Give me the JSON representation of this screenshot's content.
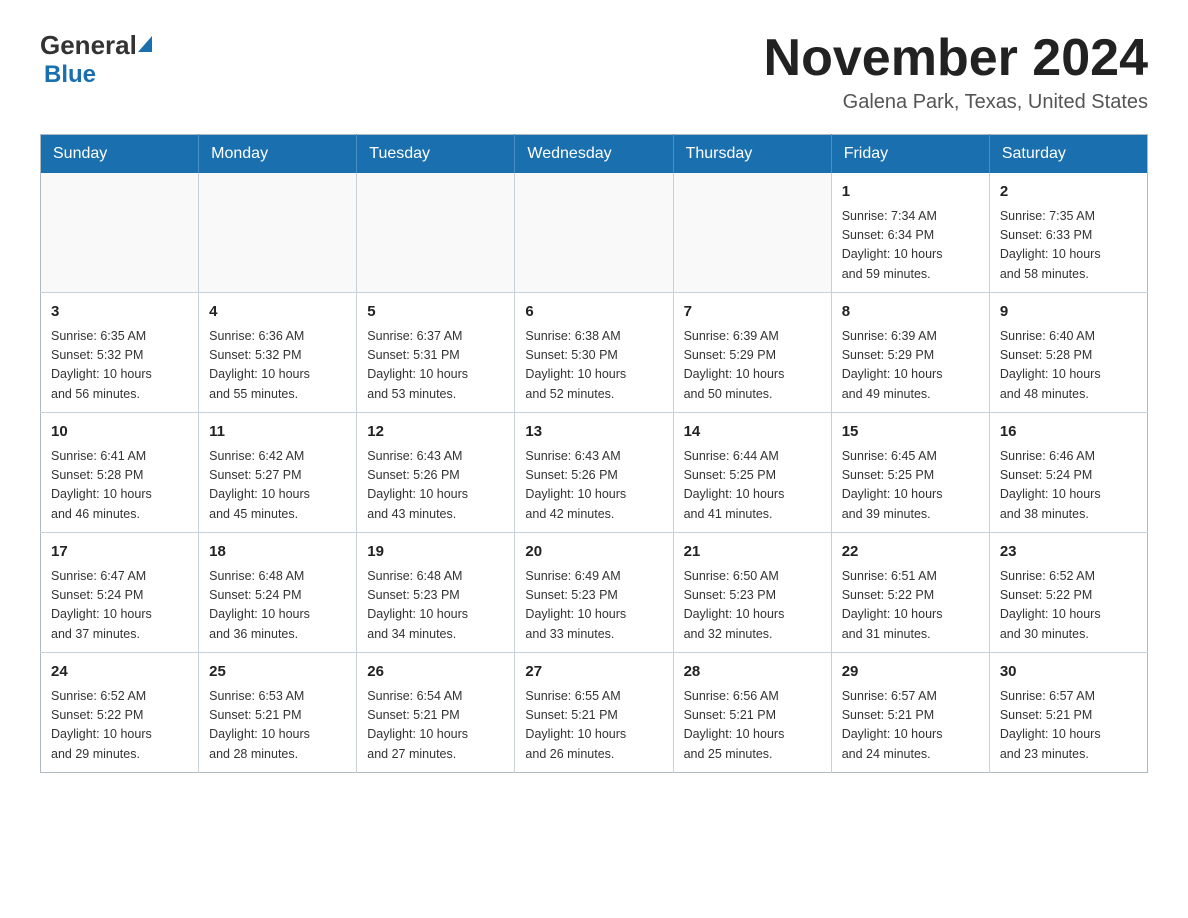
{
  "header": {
    "logo_general": "General",
    "logo_blue": "Blue",
    "month_title": "November 2024",
    "location": "Galena Park, Texas, United States"
  },
  "weekdays": [
    "Sunday",
    "Monday",
    "Tuesday",
    "Wednesday",
    "Thursday",
    "Friday",
    "Saturday"
  ],
  "rows": [
    [
      {
        "day": "",
        "info": ""
      },
      {
        "day": "",
        "info": ""
      },
      {
        "day": "",
        "info": ""
      },
      {
        "day": "",
        "info": ""
      },
      {
        "day": "",
        "info": ""
      },
      {
        "day": "1",
        "info": "Sunrise: 7:34 AM\nSunset: 6:34 PM\nDaylight: 10 hours\nand 59 minutes."
      },
      {
        "day": "2",
        "info": "Sunrise: 7:35 AM\nSunset: 6:33 PM\nDaylight: 10 hours\nand 58 minutes."
      }
    ],
    [
      {
        "day": "3",
        "info": "Sunrise: 6:35 AM\nSunset: 5:32 PM\nDaylight: 10 hours\nand 56 minutes."
      },
      {
        "day": "4",
        "info": "Sunrise: 6:36 AM\nSunset: 5:32 PM\nDaylight: 10 hours\nand 55 minutes."
      },
      {
        "day": "5",
        "info": "Sunrise: 6:37 AM\nSunset: 5:31 PM\nDaylight: 10 hours\nand 53 minutes."
      },
      {
        "day": "6",
        "info": "Sunrise: 6:38 AM\nSunset: 5:30 PM\nDaylight: 10 hours\nand 52 minutes."
      },
      {
        "day": "7",
        "info": "Sunrise: 6:39 AM\nSunset: 5:29 PM\nDaylight: 10 hours\nand 50 minutes."
      },
      {
        "day": "8",
        "info": "Sunrise: 6:39 AM\nSunset: 5:29 PM\nDaylight: 10 hours\nand 49 minutes."
      },
      {
        "day": "9",
        "info": "Sunrise: 6:40 AM\nSunset: 5:28 PM\nDaylight: 10 hours\nand 48 minutes."
      }
    ],
    [
      {
        "day": "10",
        "info": "Sunrise: 6:41 AM\nSunset: 5:28 PM\nDaylight: 10 hours\nand 46 minutes."
      },
      {
        "day": "11",
        "info": "Sunrise: 6:42 AM\nSunset: 5:27 PM\nDaylight: 10 hours\nand 45 minutes."
      },
      {
        "day": "12",
        "info": "Sunrise: 6:43 AM\nSunset: 5:26 PM\nDaylight: 10 hours\nand 43 minutes."
      },
      {
        "day": "13",
        "info": "Sunrise: 6:43 AM\nSunset: 5:26 PM\nDaylight: 10 hours\nand 42 minutes."
      },
      {
        "day": "14",
        "info": "Sunrise: 6:44 AM\nSunset: 5:25 PM\nDaylight: 10 hours\nand 41 minutes."
      },
      {
        "day": "15",
        "info": "Sunrise: 6:45 AM\nSunset: 5:25 PM\nDaylight: 10 hours\nand 39 minutes."
      },
      {
        "day": "16",
        "info": "Sunrise: 6:46 AM\nSunset: 5:24 PM\nDaylight: 10 hours\nand 38 minutes."
      }
    ],
    [
      {
        "day": "17",
        "info": "Sunrise: 6:47 AM\nSunset: 5:24 PM\nDaylight: 10 hours\nand 37 minutes."
      },
      {
        "day": "18",
        "info": "Sunrise: 6:48 AM\nSunset: 5:24 PM\nDaylight: 10 hours\nand 36 minutes."
      },
      {
        "day": "19",
        "info": "Sunrise: 6:48 AM\nSunset: 5:23 PM\nDaylight: 10 hours\nand 34 minutes."
      },
      {
        "day": "20",
        "info": "Sunrise: 6:49 AM\nSunset: 5:23 PM\nDaylight: 10 hours\nand 33 minutes."
      },
      {
        "day": "21",
        "info": "Sunrise: 6:50 AM\nSunset: 5:23 PM\nDaylight: 10 hours\nand 32 minutes."
      },
      {
        "day": "22",
        "info": "Sunrise: 6:51 AM\nSunset: 5:22 PM\nDaylight: 10 hours\nand 31 minutes."
      },
      {
        "day": "23",
        "info": "Sunrise: 6:52 AM\nSunset: 5:22 PM\nDaylight: 10 hours\nand 30 minutes."
      }
    ],
    [
      {
        "day": "24",
        "info": "Sunrise: 6:52 AM\nSunset: 5:22 PM\nDaylight: 10 hours\nand 29 minutes."
      },
      {
        "day": "25",
        "info": "Sunrise: 6:53 AM\nSunset: 5:21 PM\nDaylight: 10 hours\nand 28 minutes."
      },
      {
        "day": "26",
        "info": "Sunrise: 6:54 AM\nSunset: 5:21 PM\nDaylight: 10 hours\nand 27 minutes."
      },
      {
        "day": "27",
        "info": "Sunrise: 6:55 AM\nSunset: 5:21 PM\nDaylight: 10 hours\nand 26 minutes."
      },
      {
        "day": "28",
        "info": "Sunrise: 6:56 AM\nSunset: 5:21 PM\nDaylight: 10 hours\nand 25 minutes."
      },
      {
        "day": "29",
        "info": "Sunrise: 6:57 AM\nSunset: 5:21 PM\nDaylight: 10 hours\nand 24 minutes."
      },
      {
        "day": "30",
        "info": "Sunrise: 6:57 AM\nSunset: 5:21 PM\nDaylight: 10 hours\nand 23 minutes."
      }
    ]
  ]
}
